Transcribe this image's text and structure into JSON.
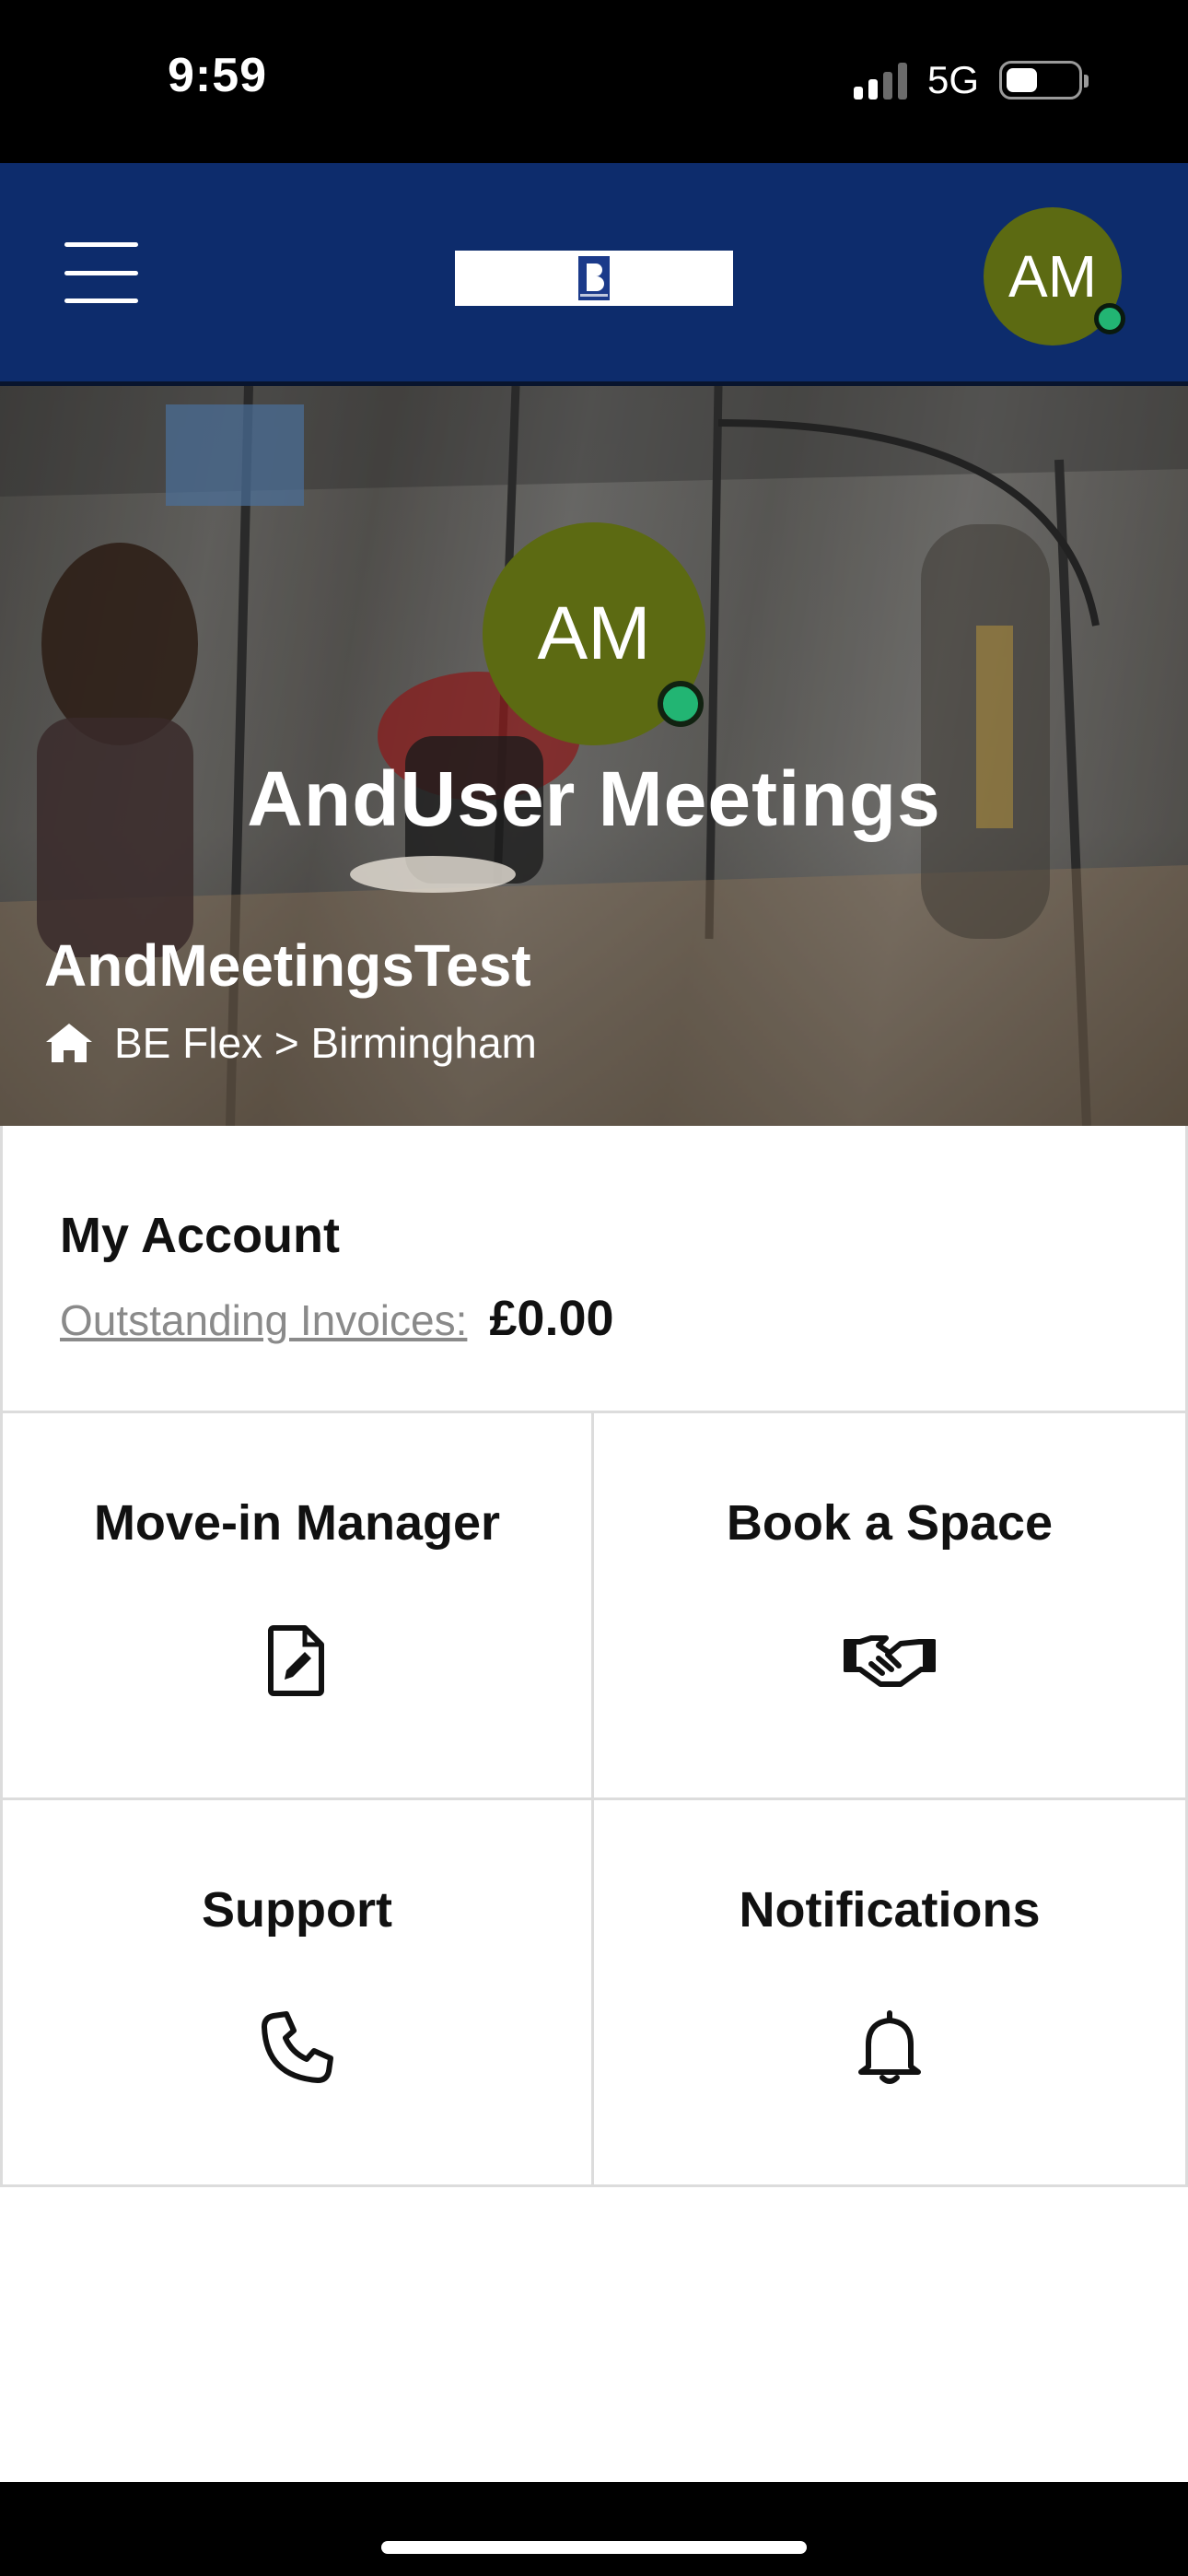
{
  "status_bar": {
    "time": "9:59",
    "network": "5G"
  },
  "header": {
    "menu_icon": "hamburger-menu-icon",
    "logo_icon": "be-logo",
    "avatar_initials": "AM"
  },
  "hero": {
    "avatar_initials": "AM",
    "user_name": "AndUser Meetings",
    "company": "AndMeetingsTest",
    "location_icon": "home-icon",
    "location": "BE Flex > Birmingham"
  },
  "account": {
    "title": "My Account",
    "invoices_label": "Outstanding Invoices:",
    "invoices_amount": "£0.00"
  },
  "tiles": [
    {
      "label": "Move-in Manager",
      "icon": "file-edit-icon"
    },
    {
      "label": "Book a Space",
      "icon": "handshake-icon"
    },
    {
      "label": "Support",
      "icon": "phone-icon"
    },
    {
      "label": "Notifications",
      "icon": "bell-icon"
    }
  ],
  "colors": {
    "header_bg": "#0d2c6c",
    "avatar_bg": "#5c6a12",
    "online_dot": "#22b573"
  }
}
